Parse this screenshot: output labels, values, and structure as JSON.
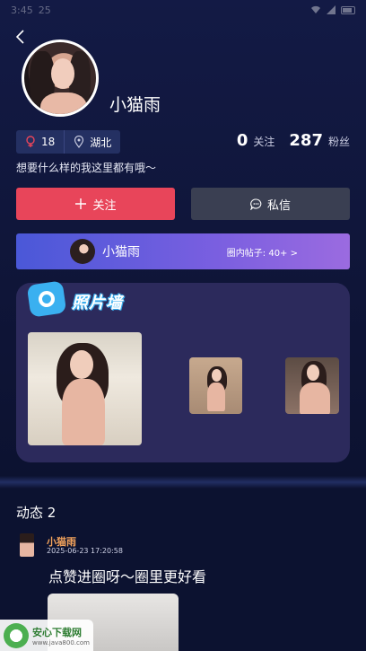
{
  "status_bar": {
    "time": "3:45",
    "extra": "25"
  },
  "profile": {
    "nickname": "小猫雨",
    "age": "18",
    "location": "湖北",
    "bio": "想要什么样的我这里都有哦～",
    "following_count": "0",
    "following_label": "关注",
    "followers_count": "287",
    "followers_label": "粉丝"
  },
  "actions": {
    "follow_label": "关注",
    "message_label": "私信"
  },
  "circle": {
    "name": "小猫雨",
    "posts": "圈内帖子: 40+ >"
  },
  "photo_wall": {
    "title": "照片墙"
  },
  "feed": {
    "title": "动态 2",
    "posts": [
      {
        "user": "小猫雨",
        "time": "2025-06-23 17:20:58",
        "text": "点赞进圈呀～圈里更好看"
      }
    ]
  },
  "watermark": {
    "title": "安心下载网",
    "url": "www.java800.com"
  },
  "colors": {
    "follow": "#e8455a",
    "message": "#3a3f52",
    "username": "#f3a35c",
    "background": "#0c1230"
  }
}
